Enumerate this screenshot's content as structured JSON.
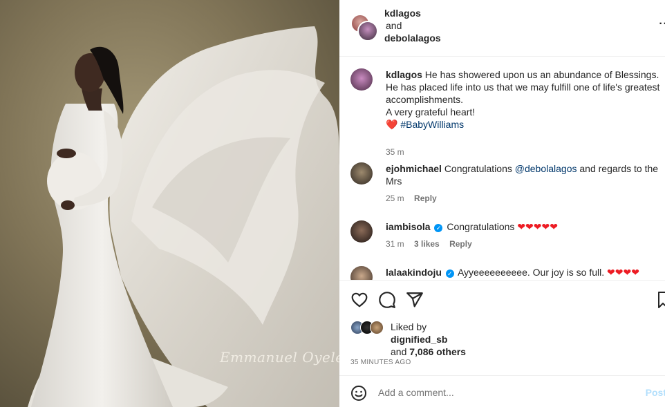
{
  "post": {
    "image_alt": "Maternity portrait in white gown with flowing fabric",
    "watermark": "Emmanuel Oyeleke"
  },
  "header": {
    "user1": "kdlagos",
    "and": "and",
    "user2": "debolalagos",
    "more_icon": "more-options-icon"
  },
  "comments": [
    {
      "user": "kdlagos",
      "text_line1": "He has showered upon us an abundance of Blessings.",
      "text_line2": "He has placed life into us that we may fulfill one of life's greatest accomplishments.",
      "text_line3": "A very grateful heart!",
      "hashtag": "#BabyWilliams",
      "heart": "❤️",
      "time": "35 m"
    },
    {
      "user": "ejohmichael",
      "text_before": "Congratulations",
      "mention": "@debolalagos",
      "text_after": "and regards to the Mrs",
      "time": "25 m",
      "reply": "Reply"
    },
    {
      "user": "iambisola",
      "text": "Congratulations",
      "hearts": "❤❤❤❤❤",
      "time": "31 m",
      "likes": "3 likes",
      "reply": "Reply"
    },
    {
      "user": "lalaakindoju",
      "text": "Ayyeeeeeeeeee. Our joy is so full.",
      "hearts": "❤❤❤❤"
    }
  ],
  "likes": {
    "liked_by": "Liked by",
    "user": "dignified_sb",
    "and": "and",
    "others": "7,086 others"
  },
  "timestamp": "35 MINUTES AGO",
  "add_comment": {
    "placeholder": "Add a comment...",
    "post_label": "Post"
  },
  "colors": {
    "link": "#00376b",
    "heart": "#ed1c24",
    "verified": "#0095f6",
    "muted": "#737373"
  }
}
